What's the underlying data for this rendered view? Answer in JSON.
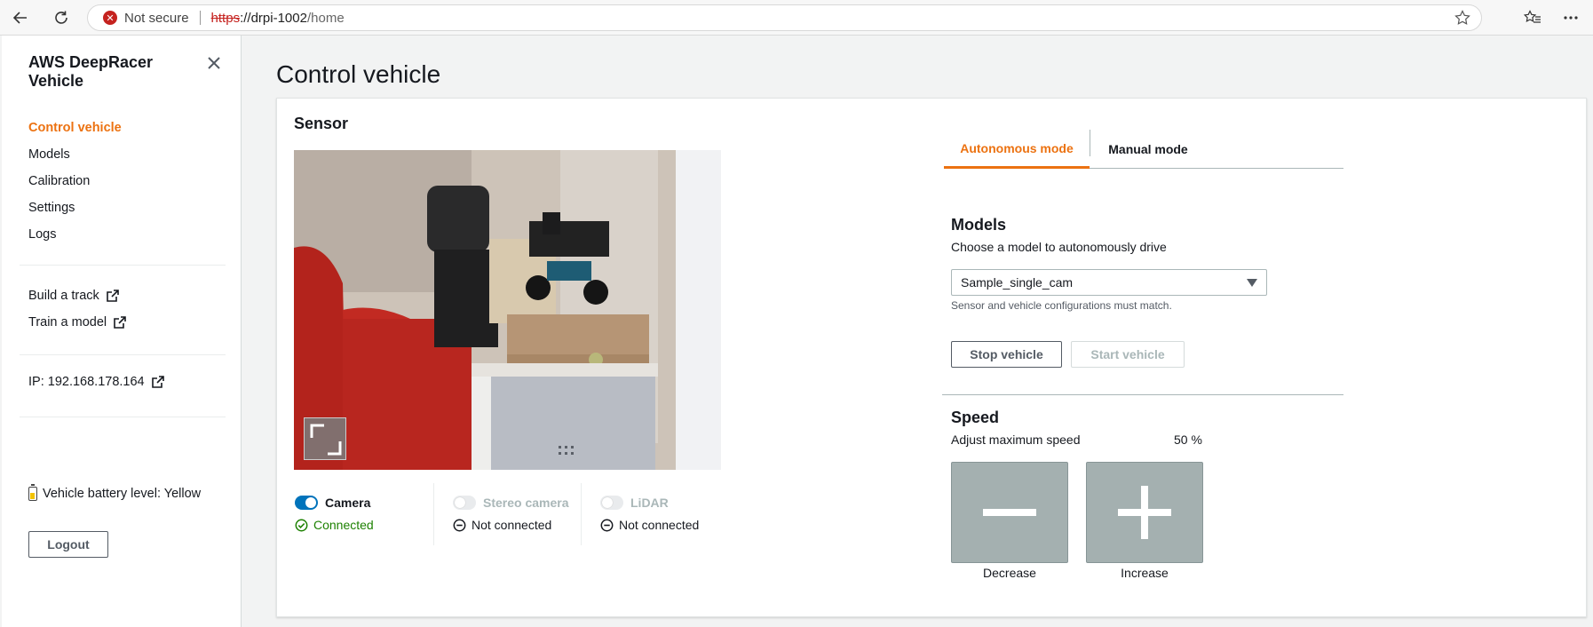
{
  "browser": {
    "security_text": "Not secure",
    "url_scheme": "https",
    "url_host": "://drpi-1002",
    "url_path": "/home"
  },
  "sidebar": {
    "title": "AWS DeepRacer Vehicle",
    "nav": [
      {
        "label": "Control vehicle",
        "active": true
      },
      {
        "label": "Models"
      },
      {
        "label": "Calibration"
      },
      {
        "label": "Settings"
      },
      {
        "label": "Logs"
      }
    ],
    "external_links": [
      {
        "label": "Build a track"
      },
      {
        "label": "Train a model"
      }
    ],
    "ip_link": "IP: 192.168.178.164",
    "battery": "Vehicle battery level: Yellow",
    "logout": "Logout"
  },
  "main": {
    "title": "Control vehicle",
    "sensor": {
      "heading": "Sensor",
      "items": [
        {
          "name": "Camera",
          "enabled": true,
          "status": "Connected"
        },
        {
          "name": "Stereo camera",
          "enabled": false,
          "status": "Not connected"
        },
        {
          "name": "LiDAR",
          "enabled": false,
          "status": "Not connected"
        }
      ]
    },
    "tabs": [
      {
        "label": "Autonomous mode",
        "active": true
      },
      {
        "label": "Manual mode"
      }
    ],
    "models": {
      "heading": "Models",
      "description": "Choose a model to autonomously drive",
      "selected": "Sample_single_cam",
      "hint": "Sensor and vehicle configurations must match.",
      "stop_label": "Stop vehicle",
      "start_label": "Start vehicle"
    },
    "speed": {
      "heading": "Speed",
      "description": "Adjust maximum speed",
      "value": "50 %",
      "decrease_label": "Decrease",
      "increase_label": "Increase"
    }
  },
  "colors": {
    "accent": "#ec7211",
    "toggle_on": "#0073bb",
    "connected": "#1d8102",
    "error": "#c5221f"
  }
}
